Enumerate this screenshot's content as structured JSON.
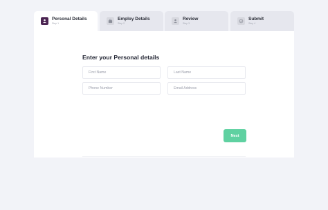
{
  "tabs": [
    {
      "title": "Personal Details",
      "sub": "Step 1",
      "icon": "user-icon",
      "active": true
    },
    {
      "title": "Employ Details",
      "sub": "Step 2",
      "icon": "briefcase-icon",
      "active": false
    },
    {
      "title": "Review",
      "sub": "Step 3",
      "icon": "user-icon",
      "active": false
    },
    {
      "title": "Submit",
      "sub": "Step 4",
      "icon": "check-icon",
      "active": false
    }
  ],
  "form": {
    "heading": "Enter your Personal details",
    "first_name_placeholder": "First Name",
    "last_name_placeholder": "Last Name",
    "phone_placeholder": "Phone Number",
    "email_placeholder": "Email Address",
    "next_label": "Next"
  },
  "colors": {
    "accent": "#4b2452",
    "next_button": "#5fd1a1",
    "background": "#f2f3f8"
  }
}
